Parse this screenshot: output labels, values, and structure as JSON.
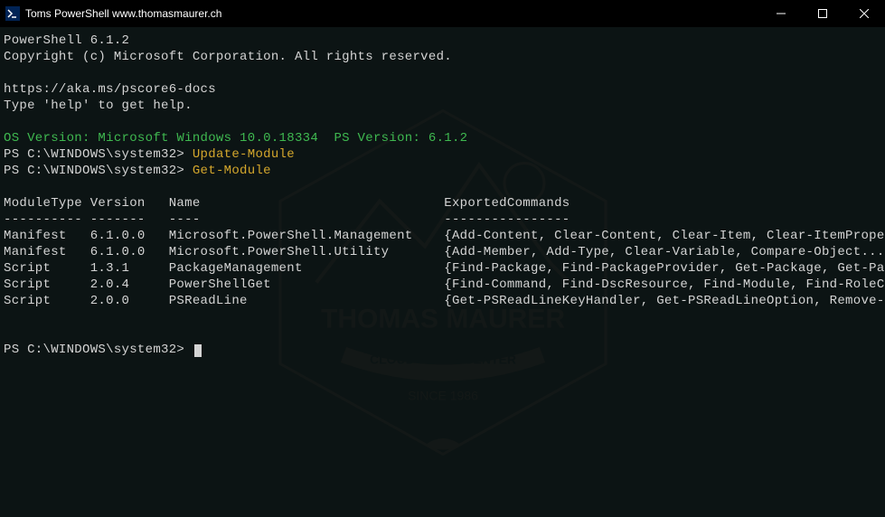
{
  "window": {
    "title": "Toms PowerShell www.thomasmaurer.ch"
  },
  "terminal": {
    "version_line": "PowerShell 6.1.2",
    "copyright": "Copyright (c) Microsoft Corporation. All rights reserved.",
    "docs_url": "https://aka.ms/pscore6-docs",
    "help_hint": "Type 'help' to get help.",
    "os_version": "OS Version: Microsoft Windows 10.0.18334  PS Version: 6.1.2",
    "prompt1": "PS C:\\WINDOWS\\system32> ",
    "command1": "Update-Module",
    "prompt2": "PS C:\\WINDOWS\\system32> ",
    "command2": "Get-Module",
    "table": {
      "header": {
        "moduleType": "ModuleType",
        "version": "Version",
        "name": "Name",
        "exported": "ExportedCommands"
      },
      "divider": {
        "moduleType": "----------",
        "version": "-------",
        "name": "----",
        "exported": "----------------"
      },
      "rows": [
        {
          "moduleType": "Manifest",
          "version": "6.1.0.0",
          "name": "Microsoft.PowerShell.Management",
          "exported": "{Add-Content, Clear-Content, Clear-Item, Clear-ItemPropert..."
        },
        {
          "moduleType": "Manifest",
          "version": "6.1.0.0",
          "name": "Microsoft.PowerShell.Utility",
          "exported": "{Add-Member, Add-Type, Clear-Variable, Compare-Object...}"
        },
        {
          "moduleType": "Script",
          "version": "1.3.1",
          "name": "PackageManagement",
          "exported": "{Find-Package, Find-PackageProvider, Get-Package, Get-Pack..."
        },
        {
          "moduleType": "Script",
          "version": "2.0.4",
          "name": "PowerShellGet",
          "exported": "{Find-Command, Find-DscResource, Find-Module, Find-RoleCap..."
        },
        {
          "moduleType": "Script",
          "version": "2.0.0",
          "name": "PSReadLine",
          "exported": "{Get-PSReadLineKeyHandler, Get-PSReadLineOption, Remove-PS..."
        }
      ]
    },
    "prompt3": "PS C:\\WINDOWS\\system32> "
  }
}
